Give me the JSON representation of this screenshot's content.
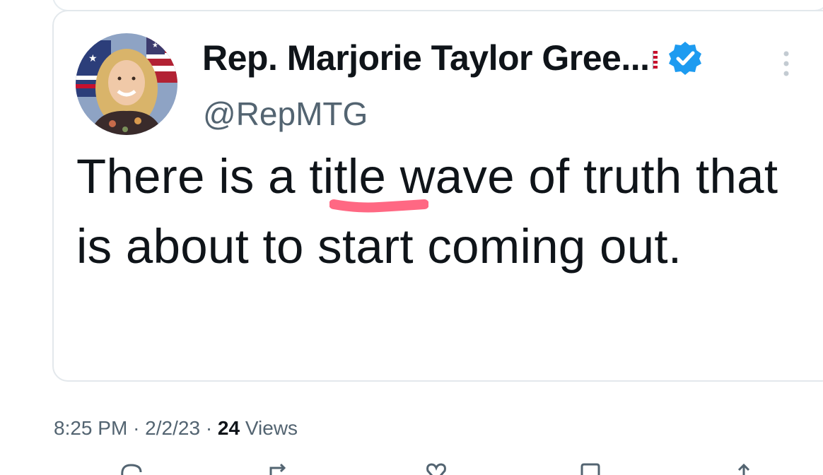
{
  "quoted_tweet": {
    "author": {
      "display_name": "Rep. Marjorie Taylor Gree...",
      "handle": "@RepMTG",
      "verified": true,
      "avatar_icon": "avatar-photo",
      "flag_icon": "us-flag-emoji-icon"
    },
    "text": "There is a title wave of truth that is about to start coming out.",
    "highlighted_word": "title",
    "highlight_color": "#ff4d6d"
  },
  "meta": {
    "time": "8:25 PM",
    "separator": "·",
    "date": "2/2/23",
    "views_count": "24",
    "views_label": "Views"
  },
  "actions": [
    {
      "name": "reply",
      "icon": "reply-icon"
    },
    {
      "name": "retweet",
      "icon": "retweet-icon"
    },
    {
      "name": "like",
      "icon": "heart-icon"
    },
    {
      "name": "bookmark",
      "icon": "bookmark-icon"
    },
    {
      "name": "share",
      "icon": "share-icon"
    }
  ],
  "colors": {
    "verified_blue": "#1d9bf0",
    "secondary_text": "#536471",
    "primary_text": "#0f1419",
    "border": "#e3e8ec"
  }
}
